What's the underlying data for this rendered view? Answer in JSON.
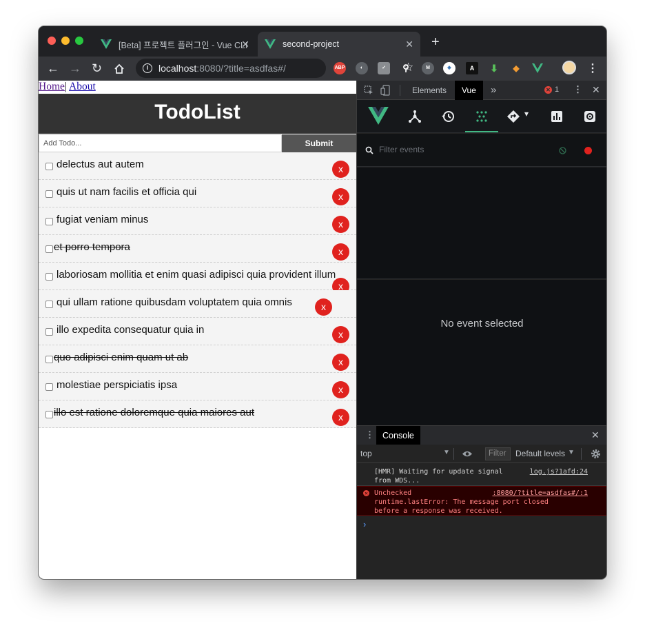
{
  "browser": {
    "tabs": [
      {
        "title": "[Beta] 프로젝트 플러그인 - Vue CLI",
        "active": false
      },
      {
        "title": "second-project",
        "active": true
      }
    ],
    "url_host": "localhost",
    "url_rest": ":8080/?title=asdfas#/"
  },
  "app": {
    "nav": {
      "home": "Home",
      "separator": "|",
      "about": "About"
    },
    "title": "TodoList",
    "input_placeholder": "Add Todo...",
    "submit_label": "Submit",
    "delete_label": "x",
    "todos": [
      {
        "title": "delectus aut autem",
        "completed": false
      },
      {
        "title": "quis ut nam facilis et officia qui",
        "completed": false
      },
      {
        "title": "fugiat veniam minus",
        "completed": false
      },
      {
        "title": "et porro tempora",
        "completed": true
      },
      {
        "title": "laboriosam mollitia et enim quasi adipisci quia provident illum",
        "completed": false
      },
      {
        "title": "qui ullam ratione quibusdam voluptatem quia omnis",
        "completed": false
      },
      {
        "title": "illo expedita consequatur quia in",
        "completed": false
      },
      {
        "title": "quo adipisci enim quam ut ab",
        "completed": true
      },
      {
        "title": "molestiae perspiciatis ipsa",
        "completed": false
      },
      {
        "title": "illo est ratione doloremque quia maiores aut",
        "completed": true
      }
    ]
  },
  "devtools": {
    "tabs": {
      "elements": "Elements",
      "vue": "Vue",
      "more": "»"
    },
    "error_count": "1",
    "vue_toolbar_icons": [
      "vue-logo-icon",
      "components-icon",
      "history-icon",
      "events-icon",
      "router-icon",
      "performance-icon",
      "settings-icon"
    ],
    "filter_placeholder": "Filter events",
    "no_event": "No event selected",
    "console": {
      "tab": "Console",
      "context": "top",
      "filter_placeholder": "Filter",
      "levels": "Default levels",
      "messages": [
        {
          "text": "[HMR] Waiting for update signal\nfrom WDS...",
          "source": "log.js?1afd:24",
          "level": "log"
        },
        {
          "text": "Unchecked\nruntime.lastError: The message port closed\nbefore a response was received.",
          "source": ":8080/?title=asdfas#/:1",
          "level": "error"
        }
      ],
      "prompt": "›"
    }
  },
  "colors": {
    "header_bg": "#333333",
    "delete_button": "#e0221e",
    "vue_green": "#41b883"
  }
}
